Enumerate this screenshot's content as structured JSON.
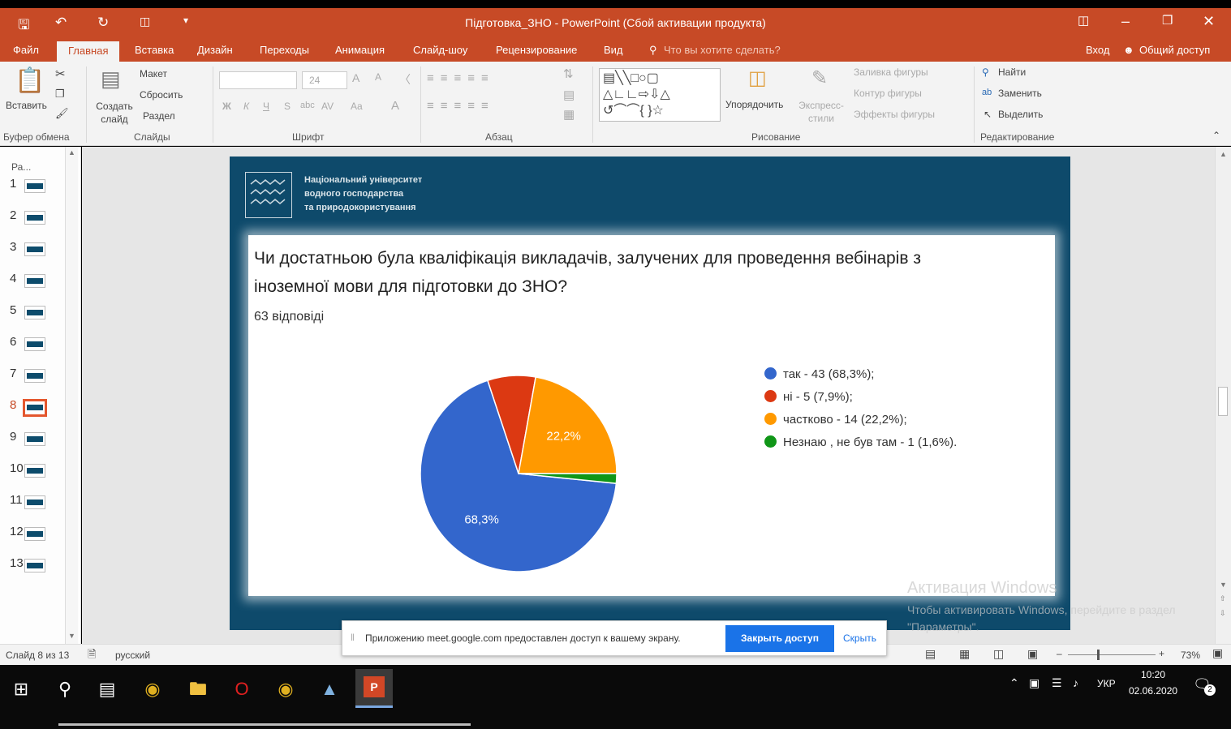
{
  "window": {
    "title": "Підготовка_ЗНО - PowerPoint (Сбой активации продукта)"
  },
  "tabs": [
    "Файл",
    "Главная",
    "Вставка",
    "Дизайн",
    "Переходы",
    "Анимация",
    "Слайд-шоу",
    "Рецензирование",
    "Вид"
  ],
  "tellme": "Что вы хотите сделать?",
  "account": {
    "signin": "Вход",
    "share": "Общий доступ"
  },
  "ribbon": {
    "paste": "Вставить",
    "new_slide": "Создать слайд",
    "layout": "Макет",
    "reset": "Сбросить",
    "section": "Раздел",
    "font_size": "24",
    "arrange": "Упорядочить",
    "quick_styles": "Экспресс-стили",
    "shape_fill": "Заливка фигуры",
    "shape_outline": "Контур фигуры",
    "shape_effects": "Эффекты фигуры",
    "find": "Найти",
    "replace": "Заменить",
    "select": "Выделить",
    "groups": {
      "clipboard": "Буфер обмена",
      "slides": "Слайды",
      "font": "Шрифт",
      "paragraph": "Абзац",
      "drawing": "Рисование",
      "editing": "Редактирование"
    }
  },
  "slide_panel": {
    "header": "Ра...",
    "slides": [
      "1",
      "2",
      "3",
      "4",
      "5",
      "6",
      "7",
      "8",
      "9",
      "10",
      "11",
      "12",
      "13"
    ],
    "selected": "8"
  },
  "slide": {
    "logo_text": [
      "Національний університет",
      "водного господарства",
      "та природокористування"
    ],
    "question": "Чи достатньою була кваліфікація викладачів, залучених для проведення вебінарів з іноземної мови для підготовки до ЗНО?",
    "responses": "63 відповіді"
  },
  "chart_data": {
    "type": "pie",
    "slices": [
      {
        "label": "так",
        "value": 68.3,
        "color": "#3366cc",
        "legend": "так - 43 (68,3%);",
        "data_label": "68,3%"
      },
      {
        "label": "ні",
        "value": 7.9,
        "color": "#dc3912",
        "legend": "ні - 5 (7,9%);",
        "data_label": ""
      },
      {
        "label": "частково",
        "value": 22.2,
        "color": "#ff9900",
        "legend": "частково - 14 (22,2%);",
        "data_label": "22,2%"
      },
      {
        "label": "Незнаю",
        "value": 1.6,
        "color": "#109618",
        "legend": "Незнаю , не був там - 1 (1,6%).",
        "data_label": ""
      }
    ]
  },
  "activation": {
    "title": "Активация Windows",
    "text": "Чтобы активировать Windows, перейдите в раздел \"Параметры\"."
  },
  "share_bar": {
    "text": "Приложению meet.google.com предоставлен доступ к вашему экрану.",
    "stop": "Закрыть доступ",
    "hide": "Скрыть"
  },
  "status": {
    "slide": "Слайд 8 из 13",
    "lang": "русский",
    "zoom": "73%"
  },
  "taskbar": {
    "lang": "УКР",
    "time": "10:20",
    "date": "02.06.2020",
    "notif": "2"
  }
}
